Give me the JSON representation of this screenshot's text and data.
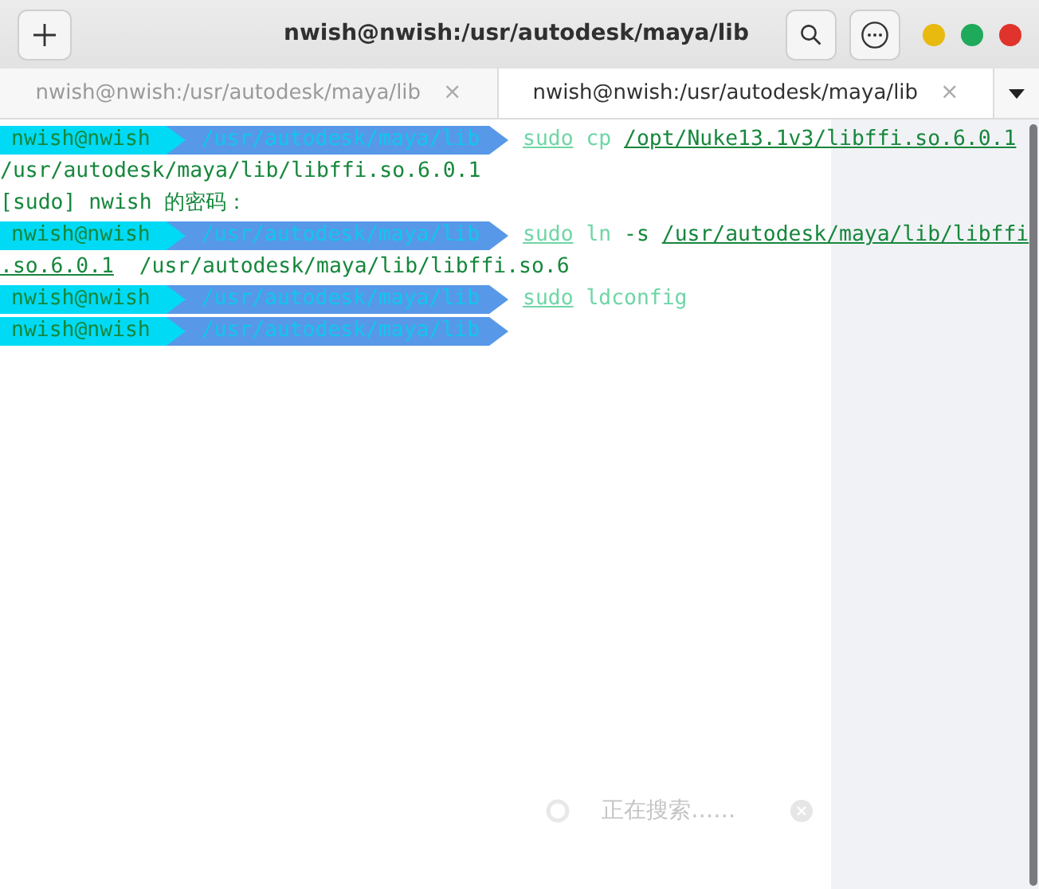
{
  "window": {
    "title": "nwish@nwish:/usr/autodesk/maya/lib"
  },
  "tabs": [
    {
      "label": "nwish@nwish:/usr/autodesk/maya/lib",
      "selected": false,
      "close": "×"
    },
    {
      "label": "nwish@nwish:/usr/autodesk/maya/lib",
      "selected": true,
      "close": "×"
    }
  ],
  "terminal": {
    "lines": [
      {
        "kind": "prompt",
        "user": "nwish@nwish",
        "path": "/usr/autodesk/maya/lib",
        "segments": [
          {
            "text": "sudo",
            "kind": "command"
          },
          {
            "text": " cp ",
            "kind": "arg"
          },
          {
            "text": "/opt/Nuke13.1v3/libffi.so.6.0.1",
            "kind": "path"
          }
        ]
      },
      {
        "kind": "output",
        "segments": [
          {
            "text": "/usr/autodesk/maya/lib/libffi.so.6.0.1",
            "kind": "plain"
          }
        ]
      },
      {
        "kind": "output",
        "segments": [
          {
            "text": "[sudo] nwish 的密码：",
            "kind": "plain"
          }
        ]
      },
      {
        "kind": "prompt",
        "user": "nwish@nwish",
        "path": "/usr/autodesk/maya/lib",
        "segments": [
          {
            "text": "sudo",
            "kind": "command"
          },
          {
            "text": " ln ",
            "kind": "arg"
          },
          {
            "text": "-s ",
            "kind": "plain"
          },
          {
            "text": "/usr/autodesk/maya/lib/libffi",
            "kind": "path"
          }
        ]
      },
      {
        "kind": "output",
        "segments": [
          {
            "text": ".so.6.0.1",
            "kind": "path"
          },
          {
            "text": "  /usr/autodesk/maya/lib/libffi.so.6",
            "kind": "plain"
          }
        ]
      },
      {
        "kind": "prompt",
        "user": "nwish@nwish",
        "path": "/usr/autodesk/maya/lib",
        "segments": [
          {
            "text": "sudo",
            "kind": "command"
          },
          {
            "text": " ldconfig",
            "kind": "arg"
          }
        ]
      },
      {
        "kind": "prompt",
        "user": "nwish@nwish",
        "path": "/usr/autodesk/maya/lib"
      }
    ]
  },
  "toast": {
    "text": "正在搜索……"
  }
}
